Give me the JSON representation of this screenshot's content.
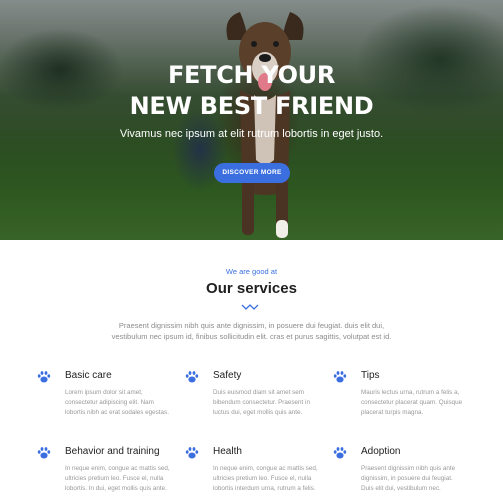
{
  "hero": {
    "title_line1": "FETCH YOUR",
    "title_line2": "NEW BEST FRIEND",
    "subtitle": "Vivamus nec ipsum at elit rutrum lobortis in eget justo.",
    "button_label": "DISCOVER MORE"
  },
  "services_section": {
    "eyebrow": "We are good at",
    "title": "Our services",
    "intro_line1": "Praesent dignissim nibh quis ante dignissim, in posuere dui feugiat. duis elit dui,",
    "intro_line2": "vestibulum nec ipsum id, finibus sollicitudin elit. cras et purus sagittis, volutpat est id.",
    "accent_color": "#3b6fe0",
    "items": [
      {
        "icon": "paw-icon",
        "title": "Basic care",
        "line1": "Lorem ipsum dolor sit amet,",
        "line2": "consectetur adipiscing elit. Nam",
        "line3": "lobortis nibh ac erat sodales egestas."
      },
      {
        "icon": "paw-icon",
        "title": "Safety",
        "line1": "Duis euismod diam sit amet sem",
        "line2": "bibendum consectetur. Praesent in",
        "line3": "luctus dui, eget mollis quis ante."
      },
      {
        "icon": "paw-icon",
        "title": "Tips",
        "line1": "Mauris lectus urna, rutrum a felis a,",
        "line2": "consectetur placerat quam. Quisque",
        "line3": "placerat turpis magna."
      },
      {
        "icon": "paw-icon",
        "title": "Behavior and training",
        "line1": "In neque enim, congue ac mattis sed,",
        "line2": "ultricies pretium leo. Fusce el, nulla",
        "line3": "lobortis. In dui, eget mollis quis ante."
      },
      {
        "icon": "paw-icon",
        "title": "Health",
        "line1": "In neque enim, congue ac mattis sed,",
        "line2": "ultricies pretium leo. Fusce el, nulla",
        "line3": "lobortis interdum urna, rutrum a felis."
      },
      {
        "icon": "paw-icon",
        "title": "Adoption",
        "line1": "Praesent dignissim nibh quis ante",
        "line2": "dignissim, in posuere dui feugiat.",
        "line3": "Duis elit dui, vestibulum nec."
      }
    ]
  }
}
